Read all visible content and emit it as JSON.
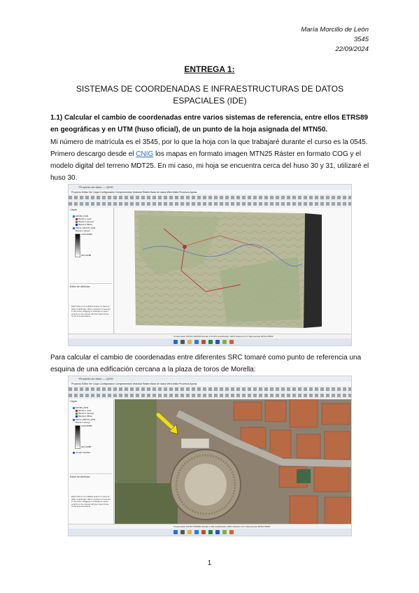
{
  "header": {
    "author": "María Morcillo de León",
    "number": "3545",
    "date": "22/09/2024"
  },
  "title": "ENTREGA 1:",
  "subtitle": "SISTEMAS DE COORDENADAS E INFRAESTRUCTURAS DE DATOS ESPACIALES (IDE)",
  "question": "1.1) Calcular el cambio de coordenadas entre varios sistemas de referencia, entre ellos ETRS89 en geográficas y en UTM (huso oficial), de un punto de la hoja asignada del MTN50.",
  "para1": {
    "before_link": "Mi número de matrícula es el 3545, por lo que la hoja con la que trabajaré durante el curso es la 0545. Primero descargo desde el ",
    "link": "CNIG",
    "after_link": " los mapas en formato imagen MTN25 Ráster en formato COG y el modelo digital del terreno MDT25. En mi caso, mi hoja se encuentra cerca del huso 30 y 31, utilizaré el huso 30."
  },
  "para2": "Para calcular el cambio de coordenadas entre diferentes SRC tomaré como punto de referencia una esquina de una edificación cercana a la plaza de toros de Morella:",
  "page_number": "1",
  "screenshot1": {
    "window_title": "*Proyecto sin título — QGIS",
    "menu": "Proyecto  Editar  Ver  Capa  Configuración  Complementos  Vectorial  Ráster  Base de datos  Web  Malla  Procesos  Ayuda",
    "panel_title": "Capas",
    "layers": [
      "MTN50_0545",
      "Banda 1 (red)",
      "Banda 2 (Green)",
      "Banda 3 (Blue)",
      "PNOA_MDT25_0545",
      "Banda 1 (Gray)",
      "1293.36865",
      "303.23088"
    ],
    "inspector_title": "Editor de atributos",
    "help_text": "Right click on an editable feature to show its table of attributes. When a feature is hovered in the panel, dragging a rectangle to select entirely on the canvas will also select those of the hovered feature.",
    "status": "Coordenada  725130 4495708   Escala 1:54 843   Amplificador 100%   Rotación 0,0°   Representar   EPSG:25830"
  },
  "screenshot2": {
    "window_title": "*Proyecto sin título — QGIS",
    "menu": "Proyecto  Editar  Ver  Capa  Configuración  Complementos  Vectorial  Ráster  Base de datos  Web  Malla  Procesos  Ayuda",
    "panel_title": "Capas",
    "layers": [
      "MTN50_0545",
      "Banda 1 (red)",
      "Banda 2 (Green)",
      "Banda 3 (Blue)",
      "PNOA_MDT25_0545",
      "Banda 1 (Gray)",
      "1293.36865",
      "303.23088",
      "Google Satellite"
    ],
    "inspector_title": "Editor de atributos",
    "help_text": "Right click on an editable feature to show its table of attributes. When a feature is hovered in the panel, dragging a rectangle to select entirely on the canvas will also select those of the hovered feature.",
    "status": "Coordenada  742180 4499560   Escala 1:466   Amplificador 100%   Rotación 0,0°   Representar   EPSG:25830"
  },
  "colors": {
    "link": "#2a6fb5",
    "topo_bg": "#b7b99a",
    "sat_bg": "#9a8b7a",
    "arrow": "#f2e100"
  }
}
